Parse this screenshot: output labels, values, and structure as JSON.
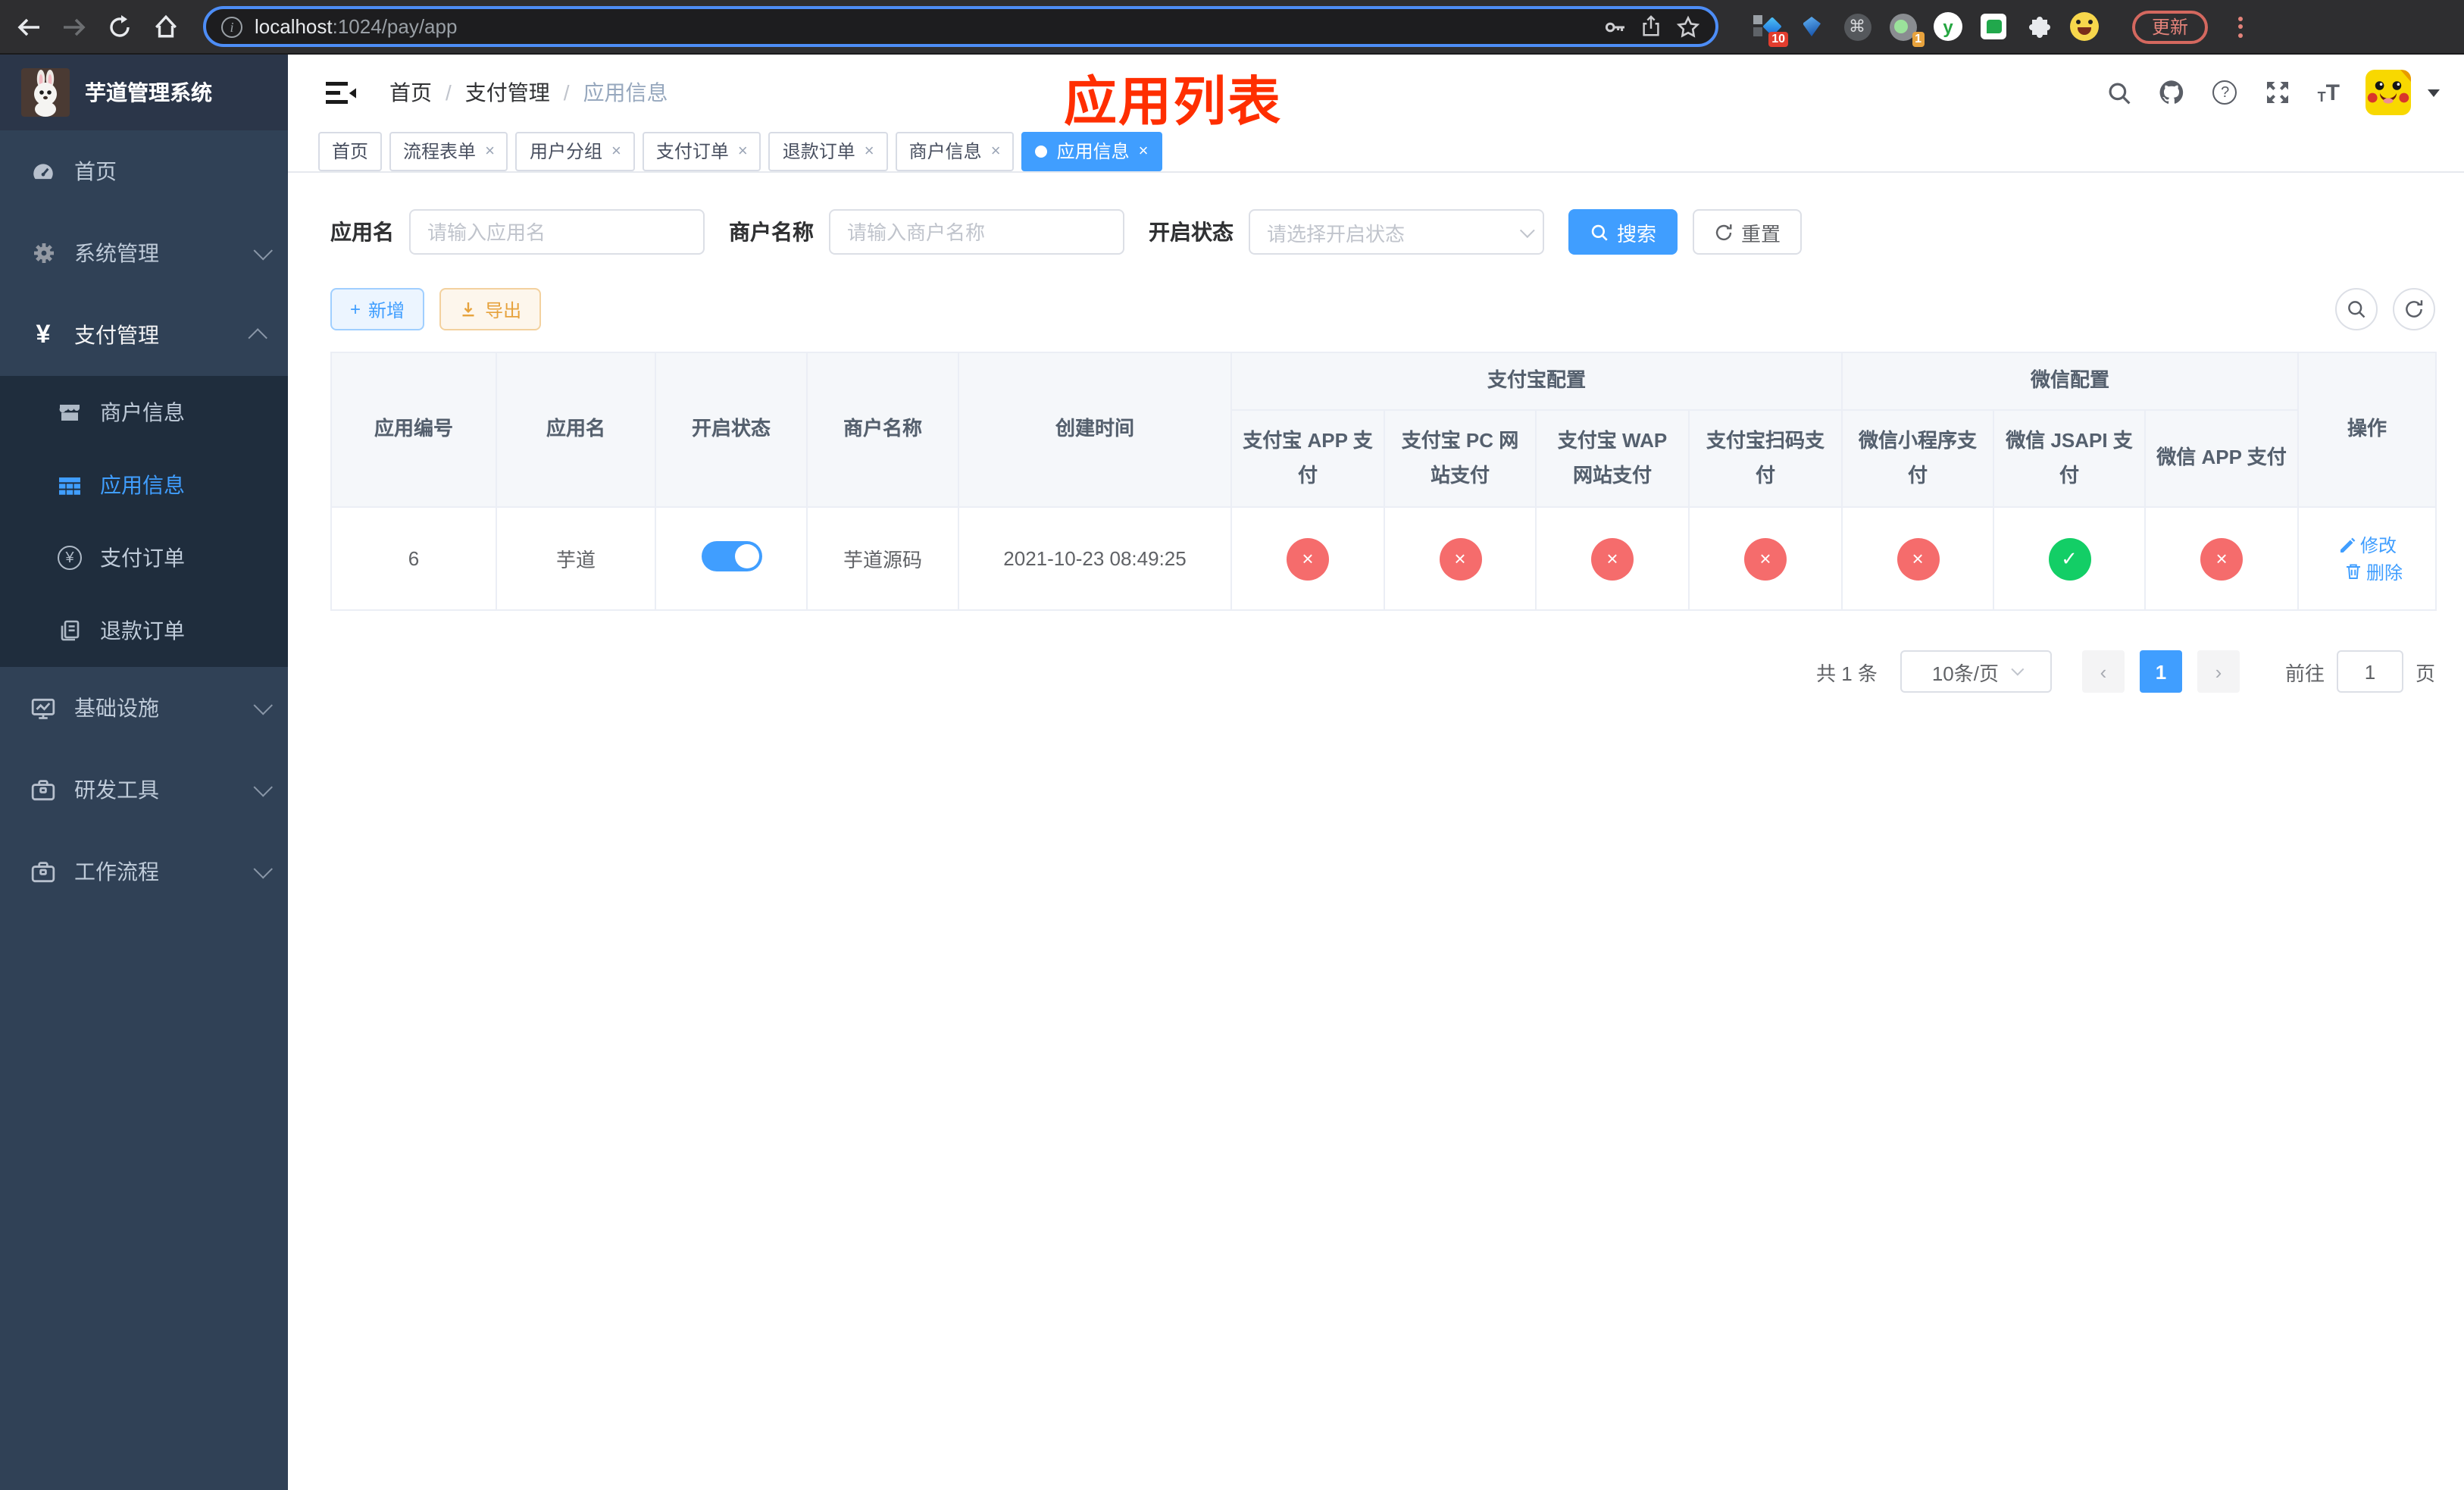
{
  "browser": {
    "url_host": "localhost",
    "url_path": ":1024/pay/app",
    "update_label": "更新",
    "ext_badge_blocks": "10",
    "ext_badge_meet": "1",
    "cmd_glyph": "⌘",
    "y_ext_glyph": "y"
  },
  "sidebar": {
    "logo_title": "芋道管理系统",
    "menu": {
      "home": "首页",
      "system": "系统管理",
      "payment": "支付管理",
      "merchant_info": "商户信息",
      "app_info": "应用信息",
      "pay_order": "支付订单",
      "refund_order": "退款订单",
      "infrastructure": "基础设施",
      "dev_tools": "研发工具",
      "workflow": "工作流程"
    },
    "yen_glyph": "¥"
  },
  "navbar": {
    "breadcrumb": {
      "home": "首页",
      "section": "支付管理",
      "current": "应用信息"
    },
    "annotation": "应用列表",
    "font_small": "T",
    "font_large": "T",
    "question_glyph": "?"
  },
  "tabs": {
    "items": [
      {
        "label": "首页",
        "closable": false,
        "active": false
      },
      {
        "label": "流程表单",
        "closable": true,
        "active": false
      },
      {
        "label": "用户分组",
        "closable": true,
        "active": false
      },
      {
        "label": "支付订单",
        "closable": true,
        "active": false
      },
      {
        "label": "退款订单",
        "closable": true,
        "active": false
      },
      {
        "label": "商户信息",
        "closable": true,
        "active": false
      },
      {
        "label": "应用信息",
        "closable": true,
        "active": true
      }
    ],
    "close_glyph": "×"
  },
  "filter": {
    "app_name_label": "应用名",
    "app_name_placeholder": "请输入应用名",
    "merchant_label": "商户名称",
    "merchant_placeholder": "请输入商户名称",
    "status_label": "开启状态",
    "status_placeholder": "请选择开启状态",
    "search_label": "搜索",
    "reset_label": "重置"
  },
  "toolbar": {
    "add_label": "新增",
    "export_label": "导出",
    "plus_glyph": "+"
  },
  "table": {
    "group_headers": {
      "alipay": "支付宝配置",
      "wechat": "微信配置"
    },
    "columns": {
      "app_id": "应用编号",
      "app_name": "应用名",
      "status": "开启状态",
      "merchant_name": "商户名称",
      "create_time": "创建时间",
      "alipay_app": "支付宝 APP 支付",
      "alipay_pc": "支付宝 PC 网站支付",
      "alipay_wap": "支付宝 WAP 网站支付",
      "alipay_qr": "支付宝扫码支付",
      "wx_lite": "微信小程序支付",
      "wx_jsapi": "微信 JSAPI 支付",
      "wx_app": "微信 APP 支付",
      "actions": "操作"
    },
    "row": {
      "app_id": "6",
      "app_name": "芋道",
      "enabled": true,
      "merchant_name": "芋道源码",
      "create_time": "2021-10-23 08:49:25",
      "channels": [
        {
          "enabled": false,
          "glyph": "×",
          "cls": "sc red"
        },
        {
          "enabled": false,
          "glyph": "×",
          "cls": "sc red"
        },
        {
          "enabled": false,
          "glyph": "×",
          "cls": "sc red"
        },
        {
          "enabled": false,
          "glyph": "×",
          "cls": "sc red"
        },
        {
          "enabled": false,
          "glyph": "×",
          "cls": "sc red"
        },
        {
          "enabled": true,
          "glyph": "✓",
          "cls": "sc green"
        },
        {
          "enabled": false,
          "glyph": "×",
          "cls": "sc red"
        }
      ],
      "edit_label": "修改",
      "delete_label": "删除"
    }
  },
  "pagination": {
    "total": "共 1 条",
    "page_size": "10条/页",
    "current_page": "1",
    "prev_glyph": "‹",
    "next_glyph": "›",
    "goto_label": "前往",
    "goto_value": "1",
    "unit_label": "页"
  }
}
